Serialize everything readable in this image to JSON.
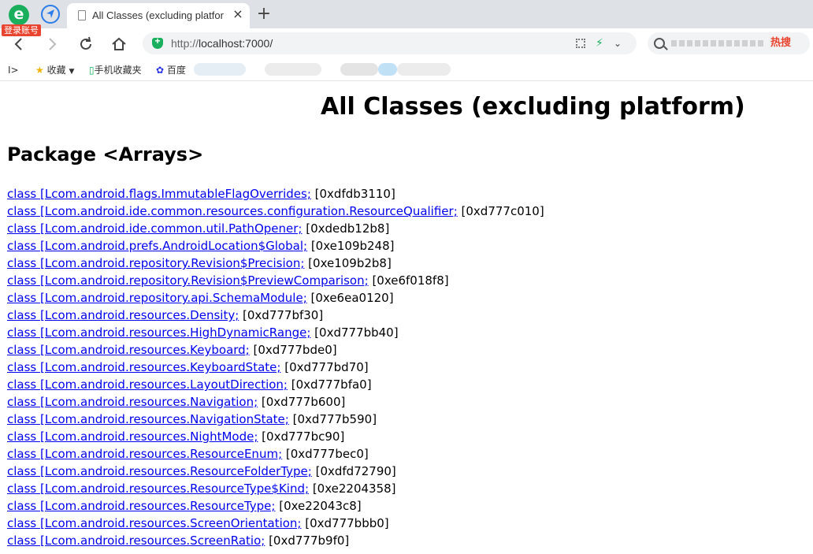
{
  "browser": {
    "login_badge": "登录账号",
    "tab_title": "All Classes (excluding platfor",
    "tab_close": "×",
    "new_tab": "+",
    "url_proto": "http://",
    "url_host": "localhost:7000/",
    "search_hot": "热搜",
    "bookmarks": {
      "toggle": "I>",
      "favorites": "收藏",
      "mobile": "手机收藏夹",
      "baidu": "百度"
    },
    "icons": [
      "browser-logo-icon",
      "navigation-app-icon",
      "page-icon",
      "back-icon",
      "forward-icon",
      "reload-icon",
      "home-icon",
      "shield-icon",
      "qr-code-icon",
      "bolt-icon",
      "chevron-down-icon",
      "search-icon",
      "star-icon",
      "phone-icon",
      "baidu-paw-icon"
    ],
    "accent": "#1aaf5d"
  },
  "page": {
    "title": "All Classes (excluding platform)",
    "heading": "Package <Arrays>",
    "link_color": "#0000ee",
    "classes": [
      {
        "name": "class [Lcom.android.flags.ImmutableFlagOverrides;",
        "addr": " [0xdfdb3110]"
      },
      {
        "name": "class [Lcom.android.ide.common.resources.configuration.ResourceQualifier;",
        "addr": " [0xd777c010]"
      },
      {
        "name": "class [Lcom.android.ide.common.util.PathOpener;",
        "addr": " [0xdedb12b8]"
      },
      {
        "name": "class [Lcom.android.prefs.AndroidLocation$Global;",
        "addr": " [0xe109b248]"
      },
      {
        "name": "class [Lcom.android.repository.Revision$Precision;",
        "addr": " [0xe109b2b8]"
      },
      {
        "name": "class [Lcom.android.repository.Revision$PreviewComparison;",
        "addr": " [0xe6f018f8]"
      },
      {
        "name": "class [Lcom.android.repository.api.SchemaModule;",
        "addr": " [0xe6ea0120]"
      },
      {
        "name": "class [Lcom.android.resources.Density;",
        "addr": " [0xd777bf30]"
      },
      {
        "name": "class [Lcom.android.resources.HighDynamicRange;",
        "addr": " [0xd777bb40]"
      },
      {
        "name": "class [Lcom.android.resources.Keyboard;",
        "addr": " [0xd777bde0]"
      },
      {
        "name": "class [Lcom.android.resources.KeyboardState;",
        "addr": " [0xd777bd70]"
      },
      {
        "name": "class [Lcom.android.resources.LayoutDirection;",
        "addr": " [0xd777bfa0]"
      },
      {
        "name": "class [Lcom.android.resources.Navigation;",
        "addr": " [0xd777b600]"
      },
      {
        "name": "class [Lcom.android.resources.NavigationState;",
        "addr": " [0xd777b590]"
      },
      {
        "name": "class [Lcom.android.resources.NightMode;",
        "addr": " [0xd777bc90]"
      },
      {
        "name": "class [Lcom.android.resources.ResourceEnum;",
        "addr": " [0xd777bec0]"
      },
      {
        "name": "class [Lcom.android.resources.ResourceFolderType;",
        "addr": " [0xdfd72790]"
      },
      {
        "name": "class [Lcom.android.resources.ResourceType$Kind;",
        "addr": " [0xe2204358]"
      },
      {
        "name": "class [Lcom.android.resources.ResourceType;",
        "addr": " [0xe22043c8]"
      },
      {
        "name": "class [Lcom.android.resources.ScreenOrientation;",
        "addr": " [0xd777bbb0]"
      },
      {
        "name": "class [Lcom.android.resources.ScreenRatio;",
        "addr": " [0xd777b9f0]"
      }
    ]
  }
}
